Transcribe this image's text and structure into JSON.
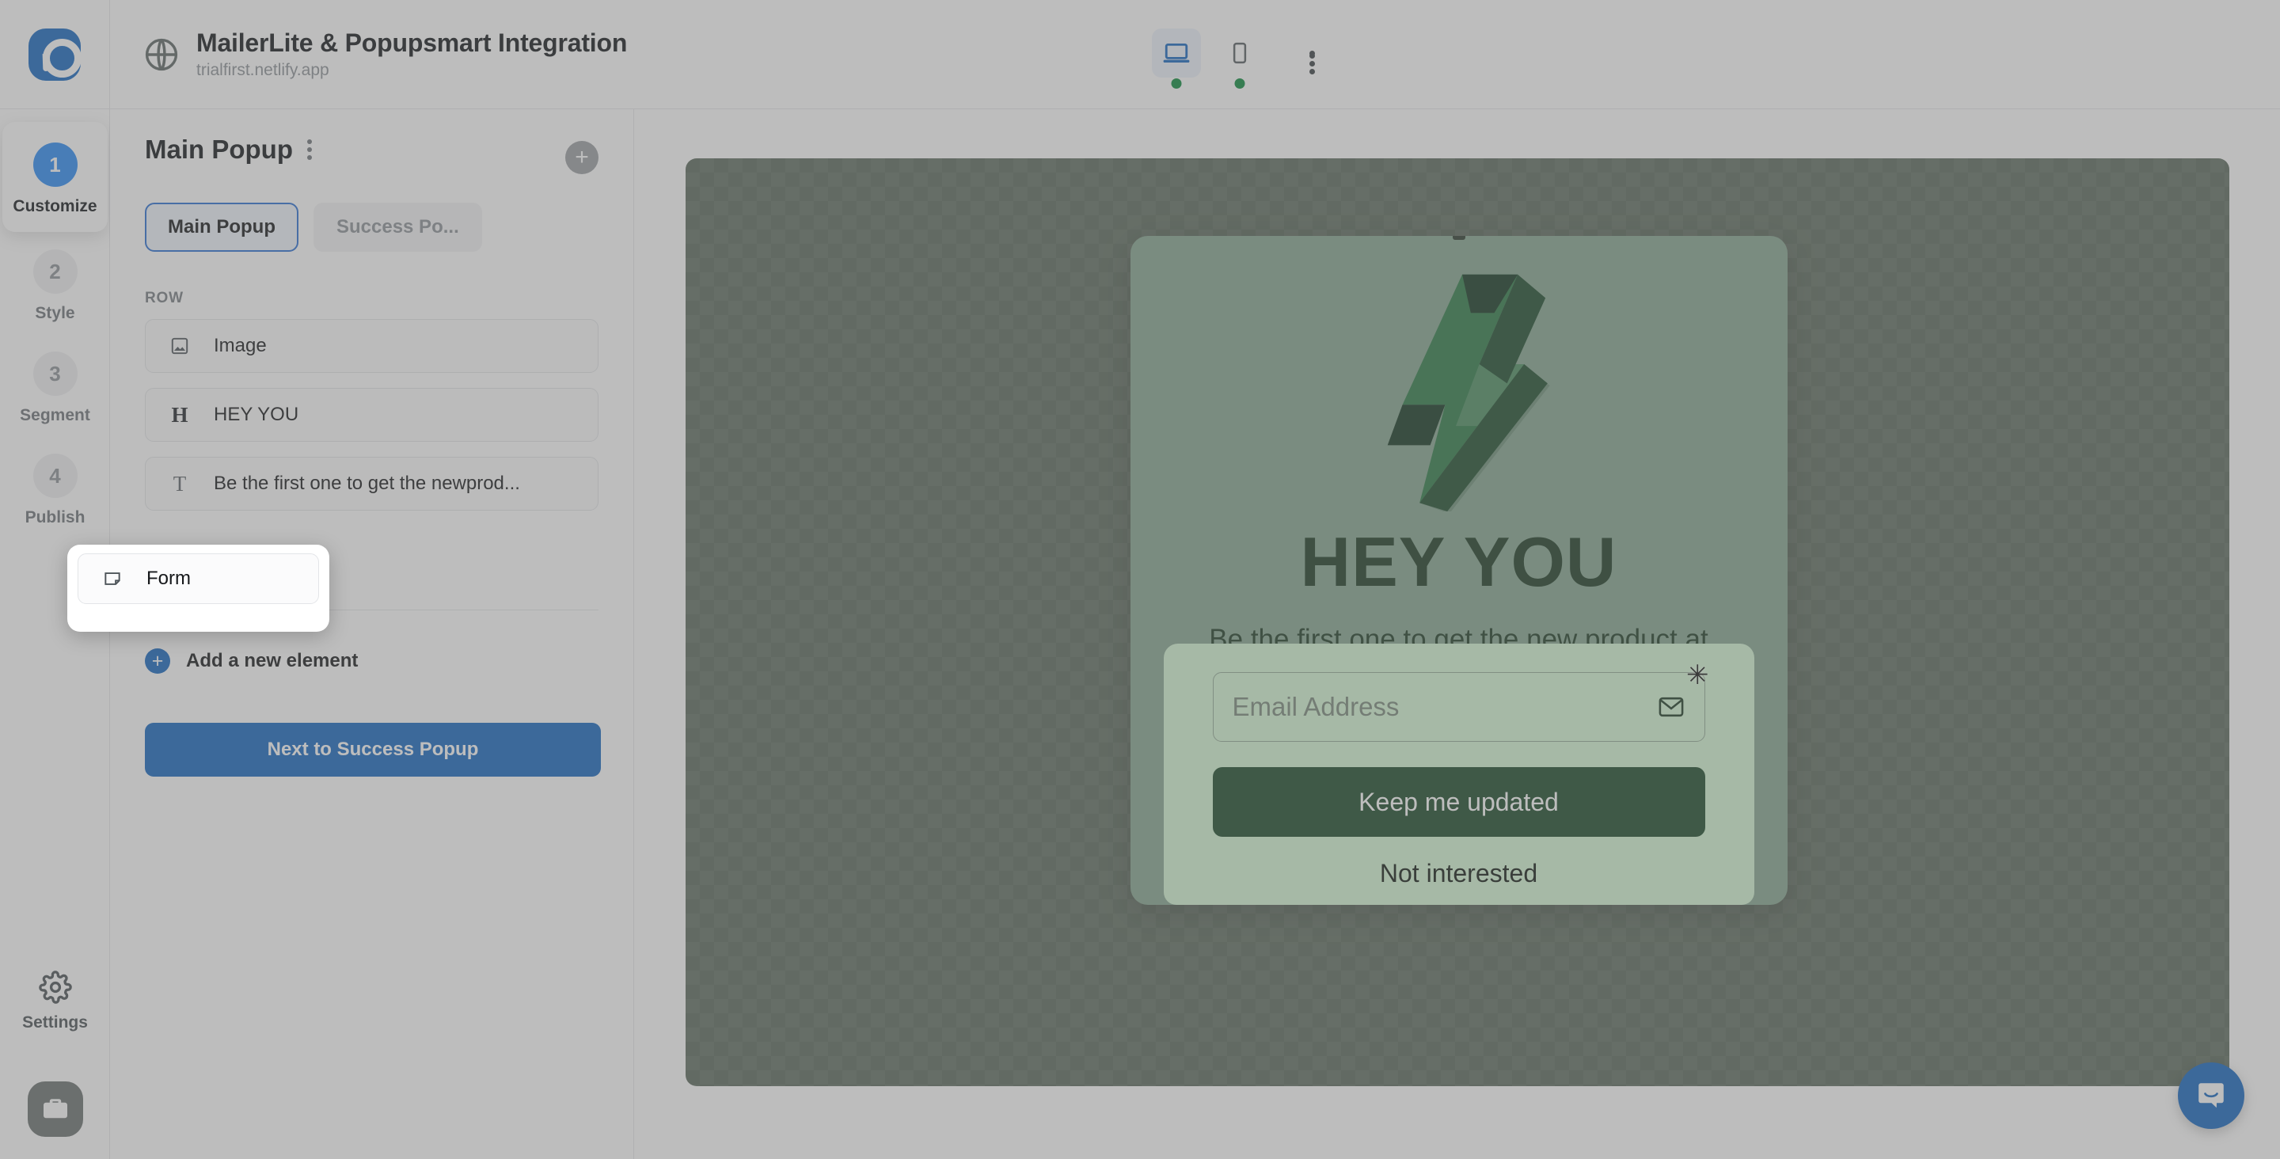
{
  "app": {
    "brand_icon": "popupsmart-logo-icon"
  },
  "header": {
    "globe_icon": "globe-icon",
    "title": "MailerLite & Popupsmart Integration",
    "url": "trialfirst.netlify.app",
    "devices": [
      {
        "name": "desktop",
        "icon": "desktop-icon",
        "active": true,
        "status": "online"
      },
      {
        "name": "mobile",
        "icon": "mobile-icon",
        "active": false,
        "status": "online"
      }
    ],
    "more_icon": "kebab-menu-icon"
  },
  "rail": {
    "steps": [
      {
        "number": "1",
        "label": "Customize",
        "active": true
      },
      {
        "number": "2",
        "label": "Style",
        "active": false
      },
      {
        "number": "3",
        "label": "Segment",
        "active": false
      },
      {
        "number": "4",
        "label": "Publish",
        "active": false
      }
    ],
    "settings": {
      "icon": "gear-icon",
      "label": "Settings"
    },
    "toolbox": {
      "icon": "toolbox-icon"
    }
  },
  "panel": {
    "title": "Main Popup",
    "kebab_icon": "kebab-menu-icon",
    "add_icon": "plus-circle-icon",
    "tabs": [
      {
        "label": "Main Popup",
        "active": true
      },
      {
        "label": "Success Po...",
        "active": false
      }
    ],
    "section_label": "ROW",
    "elements": [
      {
        "icon": "image-icon",
        "label": "Image"
      },
      {
        "icon": "heading-icon",
        "label": "HEY YOU"
      },
      {
        "icon": "text-icon",
        "label": "Be the first one to get the newprod..."
      },
      {
        "icon": "form-icon",
        "label": "Form",
        "highlighted": true
      }
    ],
    "add_element": {
      "icon": "plus-circle-icon",
      "label": "Add a new element"
    },
    "next_button": "Next to Success Popup"
  },
  "popup_preview": {
    "logo_icon": "lightning-bolt-logo-icon",
    "headline": "HEY YOU",
    "subtext": "Be the first one to get the new product at early bird prices.",
    "form": {
      "email_placeholder": "Email Address",
      "email_value": "",
      "mail_icon": "envelope-icon",
      "cursor_marker": "✳",
      "submit_label": "Keep me updated",
      "decline_label": "Not interested"
    }
  },
  "chat": {
    "icon": "chat-bubble-icon"
  },
  "colors": {
    "accent_blue": "#1566c0",
    "step_active_blue": "#2b8af5",
    "canvas_backdrop": "#5c6b5d",
    "popup_bg": "#86a791",
    "form_bg": "#d5f7d5",
    "cta_green": "#1b4a28",
    "headline_green": "#1a3a22",
    "status_green": "#0b8a3c"
  }
}
